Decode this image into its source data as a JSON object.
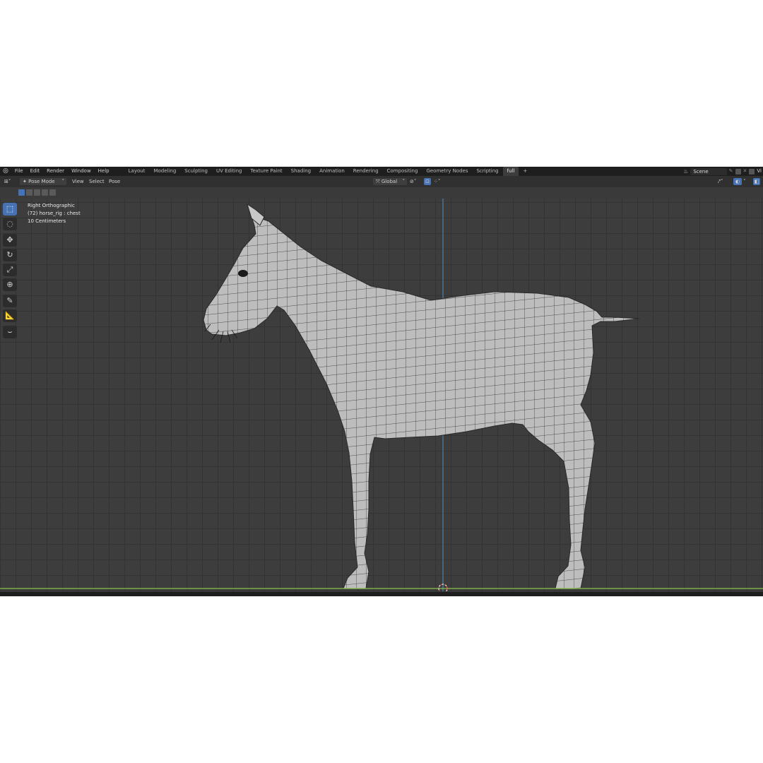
{
  "topbar": {
    "menus": [
      "File",
      "Edit",
      "Render",
      "Window",
      "Help"
    ],
    "workspaces": [
      "Layout",
      "Modeling",
      "Sculpting",
      "UV Editing",
      "Texture Paint",
      "Shading",
      "Animation",
      "Rendering",
      "Compositing",
      "Geometry Nodes",
      "Scripting",
      "full"
    ],
    "active_workspace": "full",
    "add_tab": "+",
    "scene_name": "Scene",
    "view_layer_label": "Vi"
  },
  "header": {
    "mode": "Pose Mode",
    "menus": [
      "View",
      "Select",
      "Pose"
    ],
    "transform_orientation": "Global"
  },
  "viewport_info": {
    "view_name": "Right Orthographic",
    "object_info": "(72) horse_rig : chest",
    "scale": "10 Centimeters"
  },
  "toolbar": {
    "tools": [
      "select-box",
      "cursor",
      "move",
      "rotate",
      "scale",
      "transform",
      "annotate",
      "measure",
      "relax-pose"
    ],
    "active_tool": "select-box"
  },
  "colors": {
    "viewport_bg": "#3d3d3d",
    "grid": "#333333",
    "x_axis": "#8bc34a",
    "z_axis": "#4a90c2",
    "active_blue": "#4772b3",
    "mesh_fill": "#bdbdbd",
    "wire": "#2a2a2a"
  }
}
